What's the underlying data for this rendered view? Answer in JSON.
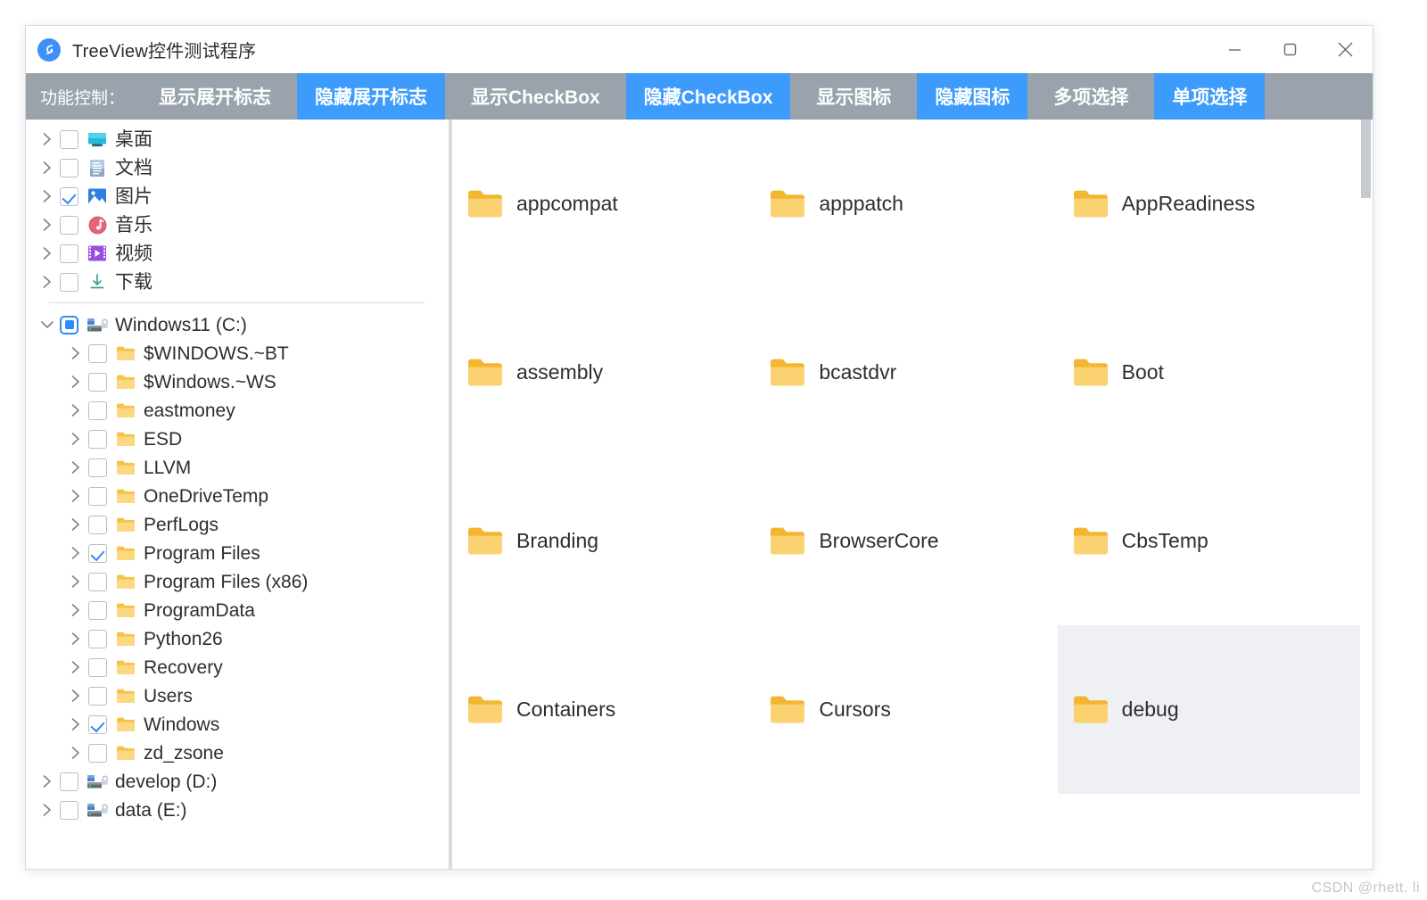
{
  "window": {
    "title": "TreeView控件测试程序",
    "app_icon": "app-logo-icon",
    "controls": {
      "minimize": "minimize-icon",
      "maximize": "maximize-icon",
      "close": "close-icon"
    }
  },
  "toolbar": {
    "label": "功能控制：",
    "accent_color": "#3d9bfb",
    "background_color": "#9aa3ac",
    "buttons": [
      {
        "label": "显示展开标志",
        "active": false
      },
      {
        "label": "隐藏展开标志",
        "active": true
      },
      {
        "label": "显示CheckBox",
        "active": false
      },
      {
        "label": "隐藏CheckBox",
        "active": true
      },
      {
        "label": "显示图标",
        "active": false
      },
      {
        "label": "隐藏图标",
        "active": true
      },
      {
        "label": "多项选择",
        "active": false
      },
      {
        "label": "单项选择",
        "active": true
      }
    ]
  },
  "tree": {
    "group_a": [
      {
        "label": "桌面",
        "icon": "desktop-icon",
        "check": "unchecked",
        "indent": false
      },
      {
        "label": "文档",
        "icon": "documents-icon",
        "check": "unchecked",
        "indent": false
      },
      {
        "label": "图片",
        "icon": "pictures-icon",
        "check": "checked",
        "indent": false
      },
      {
        "label": "音乐",
        "icon": "music-icon",
        "check": "unchecked",
        "indent": false
      },
      {
        "label": "视频",
        "icon": "video-icon",
        "check": "unchecked",
        "indent": false
      },
      {
        "label": "下载",
        "icon": "downloads-icon",
        "check": "unchecked",
        "indent": false
      }
    ],
    "group_b": [
      {
        "label": "Windows11 (C:)",
        "icon": "drive-icon",
        "check": "partial",
        "indent": false,
        "expanded": true
      },
      {
        "label": "$WINDOWS.~BT",
        "icon": "folder-icon",
        "check": "unchecked",
        "indent": true
      },
      {
        "label": "$Windows.~WS",
        "icon": "folder-icon",
        "check": "unchecked",
        "indent": true
      },
      {
        "label": "eastmoney",
        "icon": "folder-icon",
        "check": "unchecked",
        "indent": true
      },
      {
        "label": "ESD",
        "icon": "folder-icon",
        "check": "unchecked",
        "indent": true
      },
      {
        "label": "LLVM",
        "icon": "folder-icon",
        "check": "unchecked",
        "indent": true
      },
      {
        "label": "OneDriveTemp",
        "icon": "folder-icon",
        "check": "unchecked",
        "indent": true
      },
      {
        "label": "PerfLogs",
        "icon": "folder-icon",
        "check": "unchecked",
        "indent": true
      },
      {
        "label": "Program Files",
        "icon": "folder-icon",
        "check": "checked",
        "indent": true
      },
      {
        "label": "Program Files (x86)",
        "icon": "folder-icon",
        "check": "unchecked",
        "indent": true
      },
      {
        "label": "ProgramData",
        "icon": "folder-icon",
        "check": "unchecked",
        "indent": true
      },
      {
        "label": "Python26",
        "icon": "folder-icon",
        "check": "unchecked",
        "indent": true
      },
      {
        "label": "Recovery",
        "icon": "folder-icon",
        "check": "unchecked",
        "indent": true
      },
      {
        "label": "Users",
        "icon": "folder-icon",
        "check": "unchecked",
        "indent": true
      },
      {
        "label": "Windows",
        "icon": "folder-icon",
        "check": "checked",
        "indent": true
      },
      {
        "label": "zd_zsone",
        "icon": "folder-icon",
        "check": "unchecked",
        "indent": true
      },
      {
        "label": "develop (D:)",
        "icon": "drive-icon",
        "check": "unchecked",
        "indent": false
      },
      {
        "label": "data (E:)",
        "icon": "drive-icon",
        "check": "unchecked",
        "indent": false
      }
    ]
  },
  "folders": {
    "selected_name": "debug",
    "selection_color": "#eef0f4",
    "items": [
      {
        "name": "appcompat",
        "selected": false
      },
      {
        "name": "apppatch",
        "selected": false
      },
      {
        "name": "AppReadiness",
        "selected": false
      },
      {
        "name": "assembly",
        "selected": false
      },
      {
        "name": "bcastdvr",
        "selected": false
      },
      {
        "name": "Boot",
        "selected": false
      },
      {
        "name": "Branding",
        "selected": false
      },
      {
        "name": "BrowserCore",
        "selected": false
      },
      {
        "name": "CbsTemp",
        "selected": false
      },
      {
        "name": "Containers",
        "selected": false
      },
      {
        "name": "Cursors",
        "selected": false
      },
      {
        "name": "debug",
        "selected": true
      }
    ]
  },
  "watermark": "CSDN @rhett. li"
}
